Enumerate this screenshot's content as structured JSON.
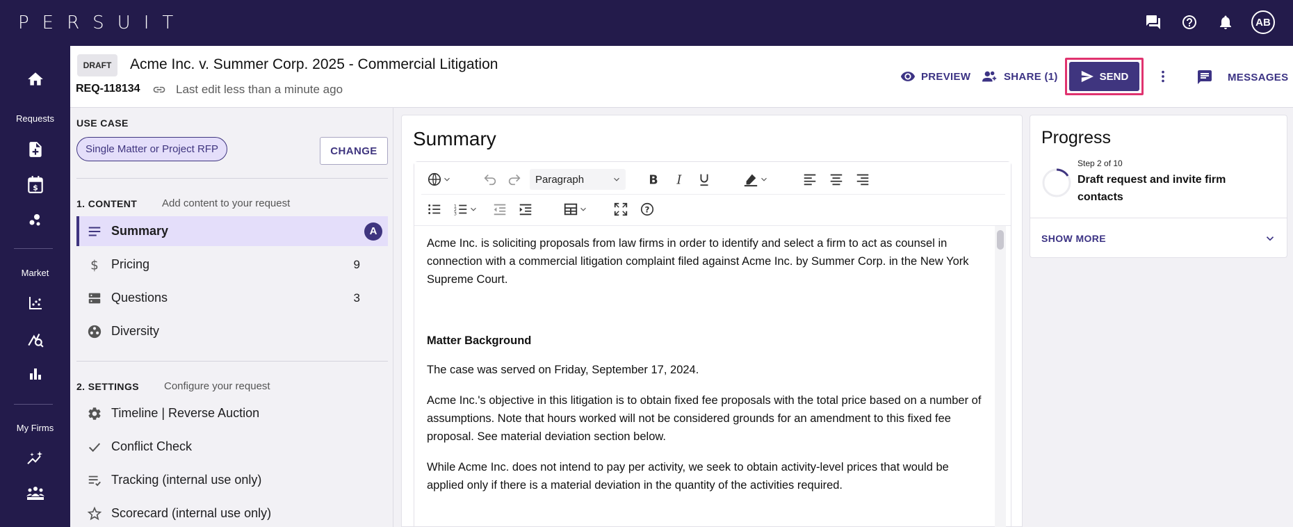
{
  "topbar": {
    "logo": "PERSUIT",
    "icons": [
      "messages-icon",
      "help-icon",
      "notifications-icon"
    ],
    "avatar_initials": "AB"
  },
  "rail": {
    "items": [
      {
        "icon": "home-icon"
      },
      {
        "label": "Requests"
      },
      {
        "icon": "new-request-icon"
      },
      {
        "icon": "calendar-dollar-icon"
      },
      {
        "icon": "bubbles-icon"
      },
      {
        "label": "Market"
      },
      {
        "icon": "scatter-chart-icon"
      },
      {
        "icon": "market-search-icon"
      },
      {
        "icon": "bar-chart-icon"
      },
      {
        "label": "My Firms"
      },
      {
        "icon": "sparkle-chart-icon"
      },
      {
        "icon": "team-icon"
      }
    ]
  },
  "header": {
    "status_badge": "DRAFT",
    "title": "Acme Inc. v. Summer Corp. 2025 - Commercial Litigation",
    "req_id": "REQ-118134",
    "last_edit": "Last edit less than a minute ago",
    "preview_label": "PREVIEW",
    "share_label": "SHARE (1)",
    "send_label": "SEND",
    "messages_label": "MESSAGES"
  },
  "sidebar": {
    "use_case_heading": "USE CASE",
    "use_case_value": "Single Matter or Project RFP",
    "change_label": "CHANGE",
    "content_heading": "1. CONTENT",
    "content_sub": "Add content to your request",
    "content_items": [
      {
        "label": "Summary",
        "badge": "A",
        "icon": "lines-icon",
        "active": true
      },
      {
        "label": "Pricing",
        "count": "9",
        "icon": "dollar-icon"
      },
      {
        "label": "Questions",
        "count": "3",
        "icon": "questions-icon"
      },
      {
        "label": "Diversity",
        "icon": "diversity-icon"
      }
    ],
    "settings_heading": "2. SETTINGS",
    "settings_sub": "Configure your request",
    "settings_items": [
      {
        "label": "Timeline | Reverse Auction",
        "icon": "gear-icon"
      },
      {
        "label": "Conflict Check",
        "icon": "check-icon"
      },
      {
        "label": "Tracking (internal use only)",
        "icon": "tracking-icon"
      },
      {
        "label": "Scorecard (internal use only)",
        "icon": "star-icon"
      }
    ]
  },
  "editor": {
    "title": "Summary",
    "paragraph_style": "Paragraph",
    "content": {
      "p1": "Acme Inc. is soliciting proposals from law firms in order to identify and select a firm to act as counsel in connection with a commercial litigation complaint filed against Acme Inc. by Summer Corp. in the New York Supreme Court.",
      "heading": "Matter Background",
      "p2": "The case was served on Friday, September 17, 2024.",
      "p3": "Acme Inc.'s objective in this litigation is to obtain fixed fee proposals with the total price based on a number of assumptions. Note that hours worked will not be considered grounds for an amendment to this fixed fee proposal. See material deviation section below.",
      "p4": "While Acme Inc. does not intend to pay per activity, we seek to obtain activity-level prices that would be applied only if there is a material deviation in the quantity of the activities required."
    }
  },
  "progress": {
    "title": "Progress",
    "step_small": "Step 2 of 10",
    "step_main": "Draft request and invite firm contacts",
    "show_more": "SHOW MORE"
  },
  "colors": {
    "brand": "#231b4b",
    "accent": "#3f357f",
    "highlight": "#e0336f"
  }
}
